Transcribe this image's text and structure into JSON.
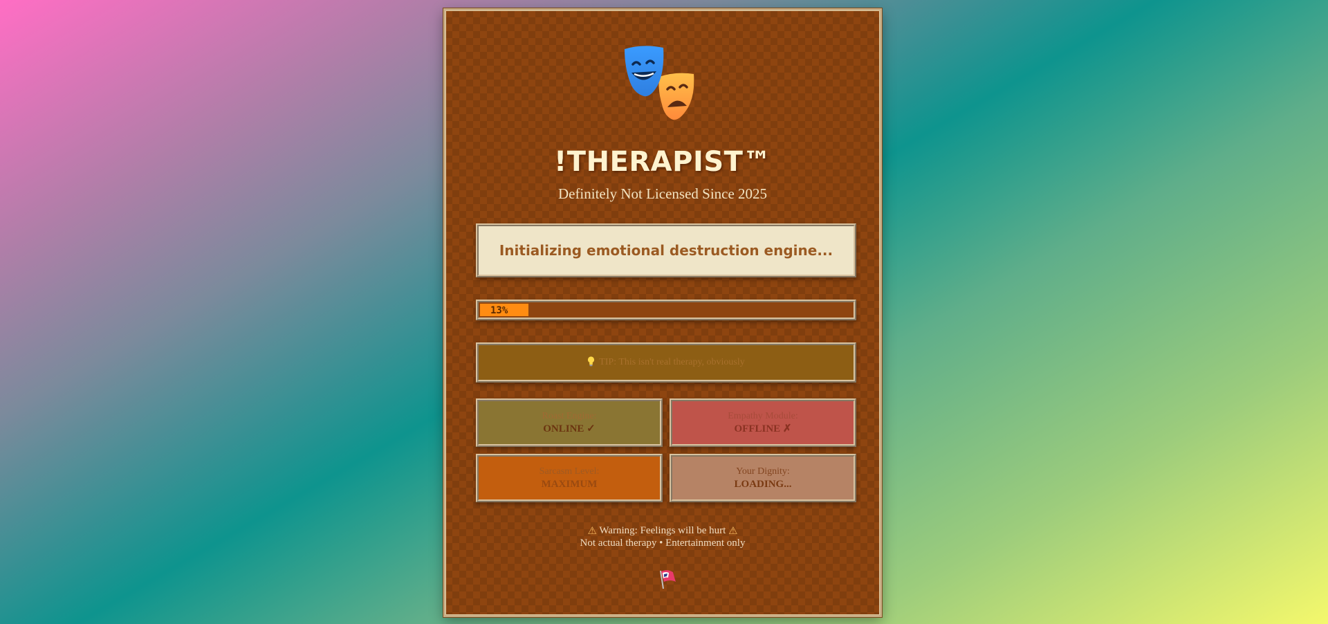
{
  "app": {
    "title": "!THERAPIST™",
    "subtitle": "Definitely Not Licensed Since 2025"
  },
  "status": {
    "message": "Initializing emotional destruction engine..."
  },
  "progress": {
    "label": "13%",
    "value": 13
  },
  "tip": {
    "icon": "lightbulb-icon",
    "text": "TIP: This isn't real therapy, obviously"
  },
  "cards": [
    {
      "label": "Roast Engine:",
      "value": "ONLINE ✓"
    },
    {
      "label": "Empathy Module:",
      "value": "OFFLINE ✗"
    },
    {
      "label": "Sarcasm Level:",
      "value": "MAXIMUM"
    },
    {
      "label": "Your Dignity:",
      "value": "LOADING..."
    }
  ],
  "footer": {
    "warning": "Warning: Feelings will be hurt",
    "note": "Not actual therapy • Entertainment only"
  },
  "icons": {
    "logo": "theater-masks-icon",
    "warning": "warning-icon",
    "bottom": "flag-icon"
  },
  "colors": {
    "progress_fill": "#ff8c12",
    "panel_bg": "#8e4510"
  }
}
